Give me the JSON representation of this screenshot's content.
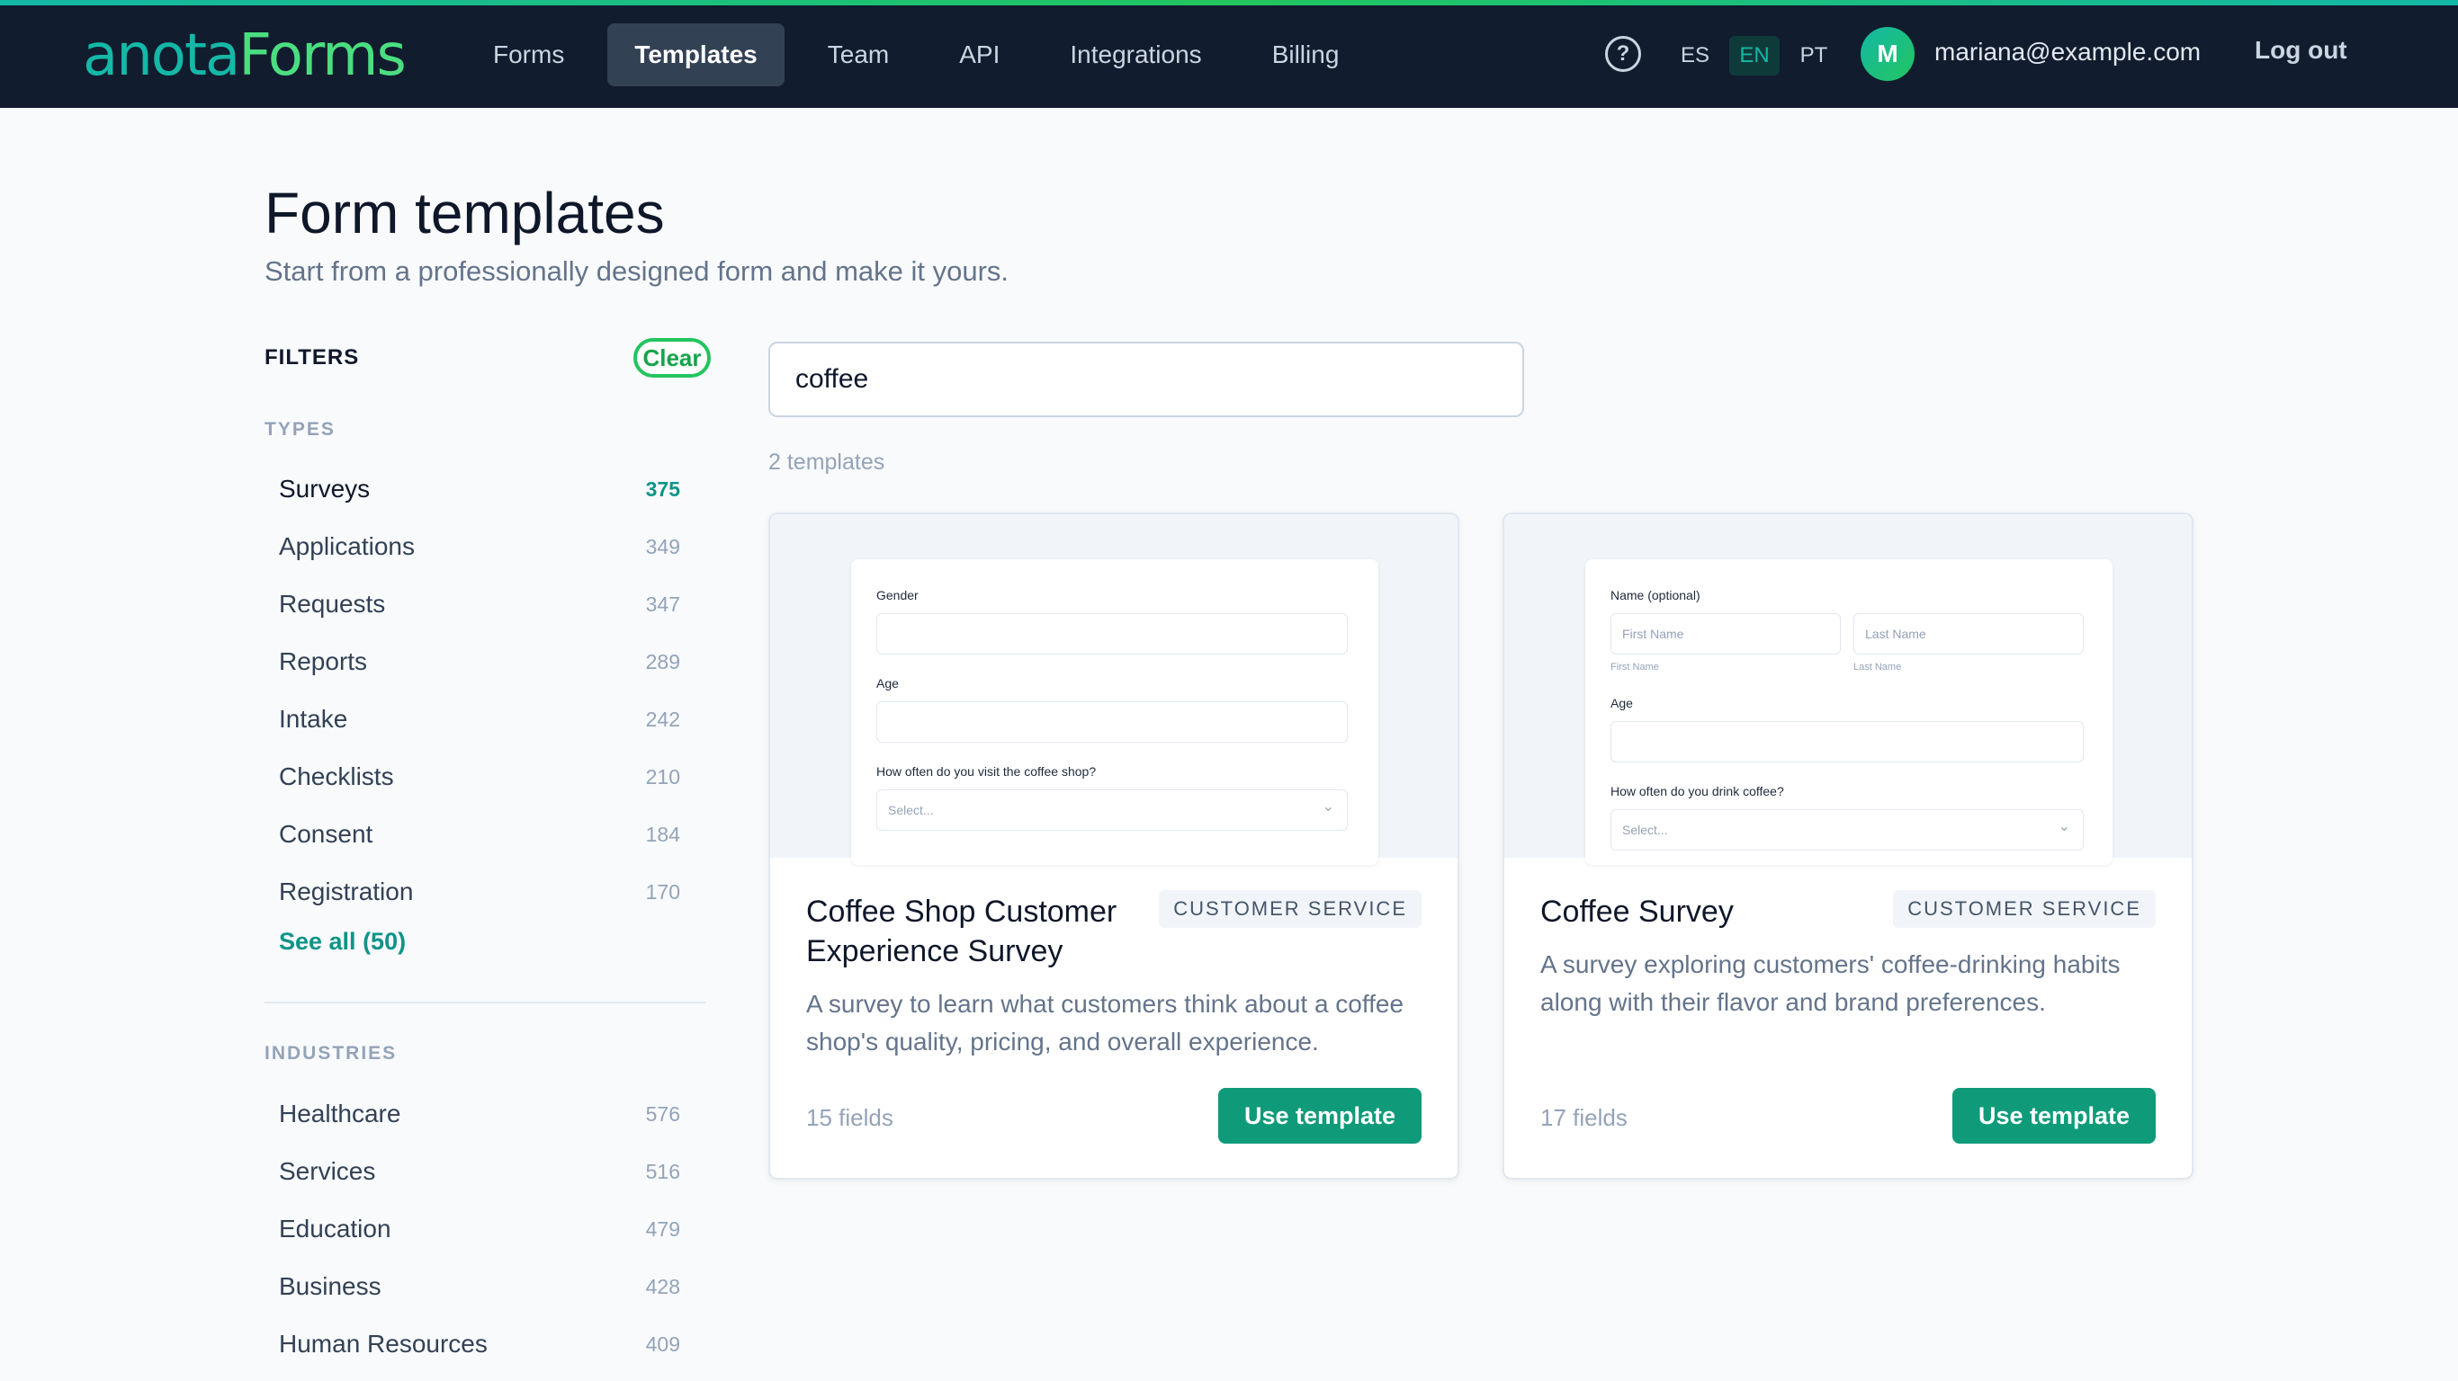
{
  "brand": {
    "logo_part1": "anota",
    "logo_part2": "Forms"
  },
  "nav": {
    "items": [
      {
        "label": "Forms"
      },
      {
        "label": "Templates"
      },
      {
        "label": "Team"
      },
      {
        "label": "API"
      },
      {
        "label": "Integrations"
      },
      {
        "label": "Billing"
      }
    ],
    "active": "Templates",
    "help_icon": "?",
    "languages": [
      "ES",
      "EN",
      "PT"
    ],
    "active_language": "EN",
    "avatar_initial": "M",
    "user_email": "mariana@example.com",
    "logout_label": "Log out"
  },
  "page": {
    "title": "Form templates",
    "subtitle": "Start from a professionally designed form and make it yours."
  },
  "sidebar": {
    "filters_label": "FILTERS",
    "clear_label": "Clear",
    "types_label": "TYPES",
    "types": [
      {
        "label": "Surveys",
        "count": "375",
        "active": true
      },
      {
        "label": "Applications",
        "count": "349"
      },
      {
        "label": "Requests",
        "count": "347"
      },
      {
        "label": "Reports",
        "count": "289"
      },
      {
        "label": "Intake",
        "count": "242"
      },
      {
        "label": "Checklists",
        "count": "210"
      },
      {
        "label": "Consent",
        "count": "184"
      },
      {
        "label": "Registration",
        "count": "170"
      }
    ],
    "see_all_label": "See all (50)",
    "industries_label": "INDUSTRIES",
    "industries": [
      {
        "label": "Healthcare",
        "count": "576"
      },
      {
        "label": "Services",
        "count": "516"
      },
      {
        "label": "Education",
        "count": "479"
      },
      {
        "label": "Business",
        "count": "428"
      },
      {
        "label": "Human Resources",
        "count": "409"
      }
    ]
  },
  "search": {
    "value": "coffee",
    "placeholder": ""
  },
  "results": {
    "count_text": "2 templates"
  },
  "templates": [
    {
      "title": "Coffee Shop Customer Experience Survey",
      "category": "CUSTOMER SERVICE",
      "description": "A survey to learn what customers think about a coffee shop's quality, pricing, and overall experience.",
      "fields": "15 fields",
      "button": "Use template",
      "preview": {
        "label1": "Gender",
        "label2": "Age",
        "label3": "How often do you visit the coffee shop?",
        "select_placeholder": "Select..."
      }
    },
    {
      "title": "Coffee Survey",
      "category": "CUSTOMER SERVICE",
      "description": "A survey exploring customers' coffee-drinking habits along with their flavor and brand preferences.",
      "fields": "17 fields",
      "button": "Use template",
      "preview": {
        "label1": "Name (optional)",
        "first_placeholder": "First Name",
        "last_placeholder": "Last Name",
        "first_hint": "First Name",
        "last_hint": "Last Name",
        "label2": "Age",
        "label3": "How often do you drink coffee?",
        "select_placeholder": "Select..."
      }
    }
  ],
  "colors": {
    "accent": "#0f9b7a",
    "nav_bg": "#111c2e",
    "brand_teal": "#14b8a6",
    "brand_green": "#4ade80"
  }
}
